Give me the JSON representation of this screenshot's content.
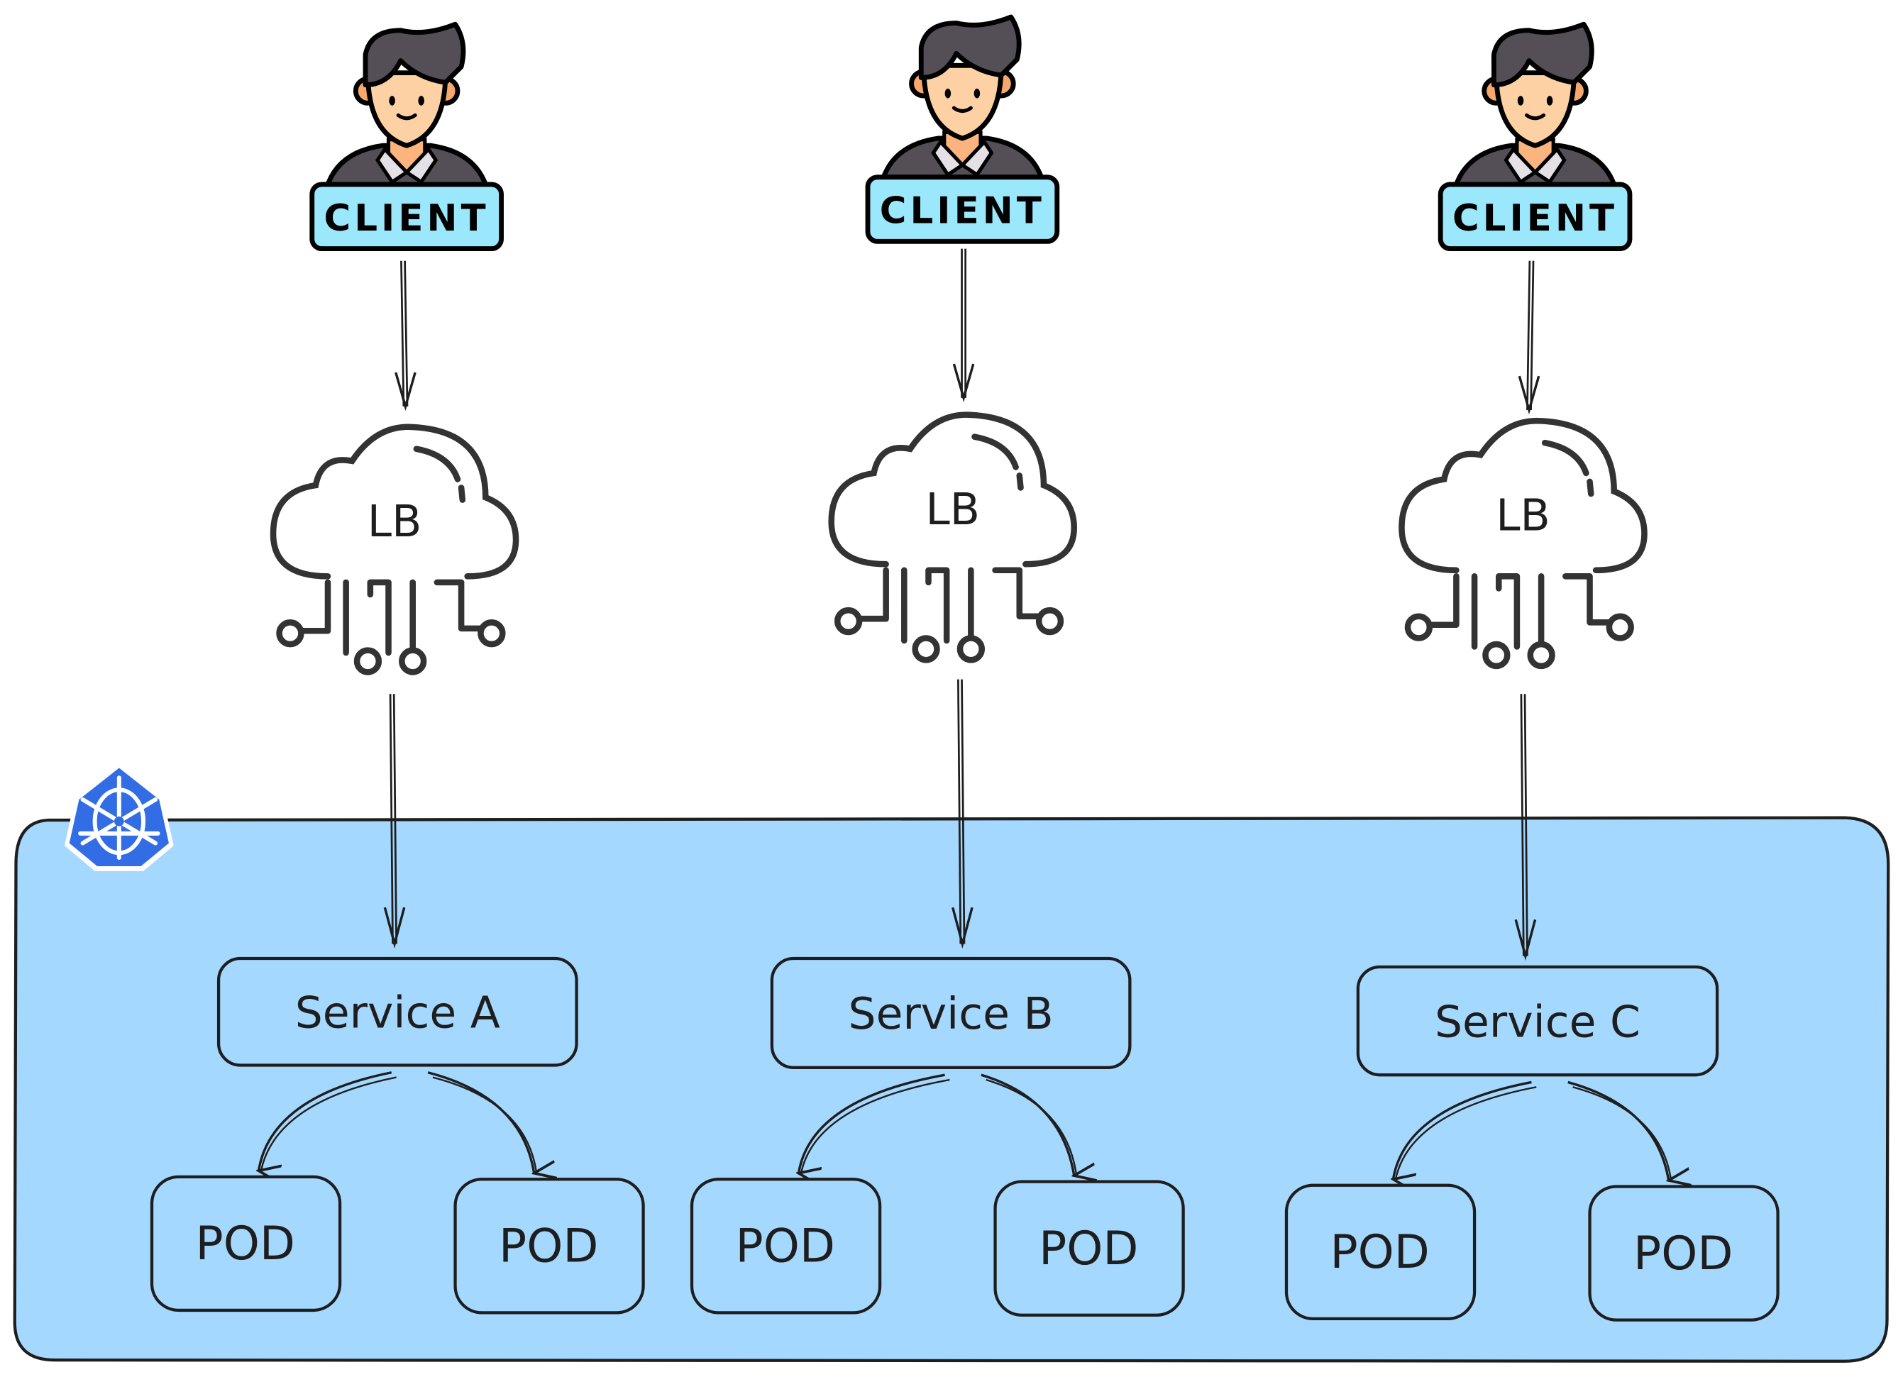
{
  "colors": {
    "cluster_fill": "#a5d8ff",
    "stroke": "#1e1e1e",
    "client_badge": "#9be7fc",
    "k8s_blue": "#326de6",
    "hair": "#544e56",
    "skin": "#fdd1a3"
  },
  "cluster": {
    "icon": "kubernetes-helm-icon"
  },
  "columns": [
    {
      "client": "CLIENT",
      "lb": "LB",
      "service": "Service A",
      "pods": [
        "POD",
        "POD"
      ]
    },
    {
      "client": "CLIENT",
      "lb": "LB",
      "service": "Service B",
      "pods": [
        "POD",
        "POD"
      ]
    },
    {
      "client": "CLIENT",
      "lb": "LB",
      "service": "Service C",
      "pods": [
        "POD",
        "POD"
      ]
    }
  ]
}
